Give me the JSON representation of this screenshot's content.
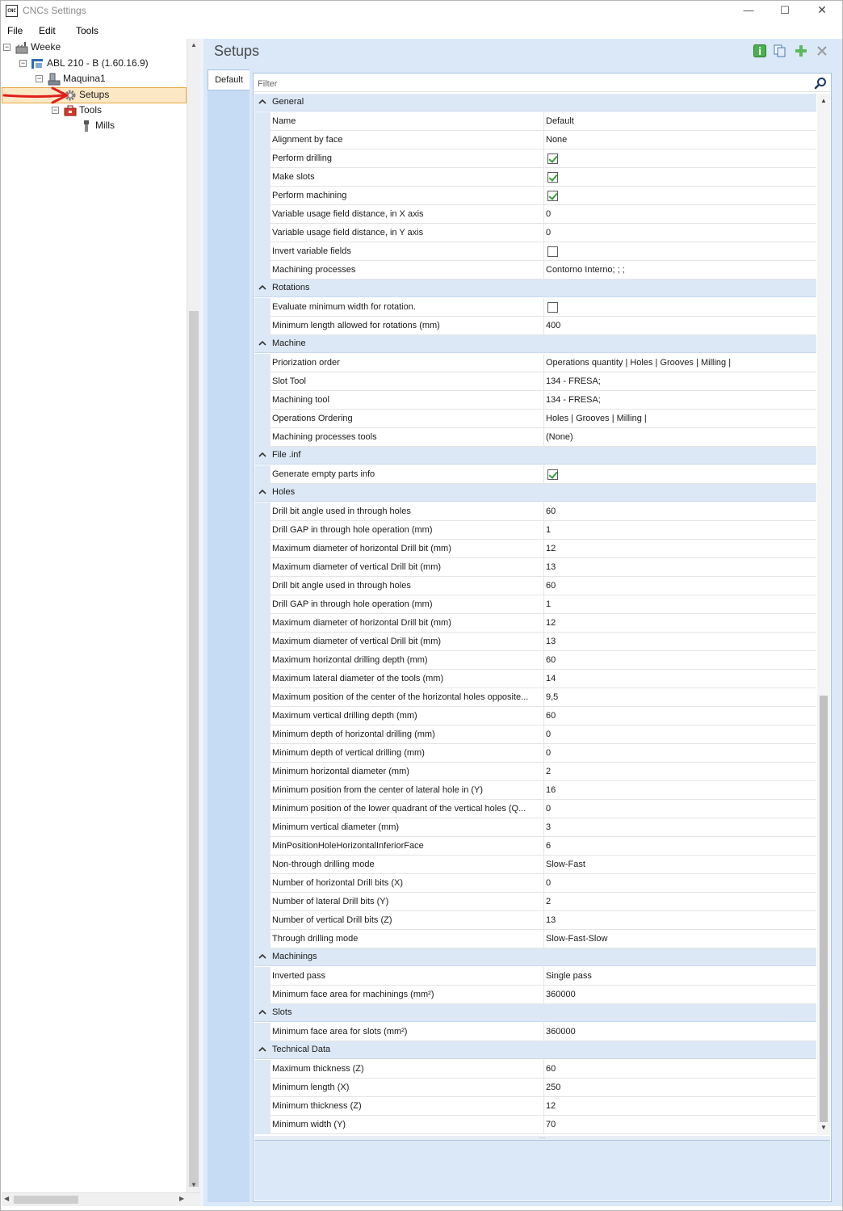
{
  "window": {
    "app_icon_text": "CNC",
    "title": "CNCs Settings",
    "minimize": "—",
    "maximize": "☐",
    "close": "✕"
  },
  "menu": [
    "File",
    "Edit",
    "Tools"
  ],
  "tree": {
    "root": "Weeke",
    "machine": "ABL 210 - B (1.60.16.9)",
    "maquina": "Maquina1",
    "setups": "Setups",
    "tools": "Tools",
    "mills": "Mills",
    "expander_open": "−"
  },
  "panel": {
    "title": "Setups",
    "tab_default": "Default",
    "filter_placeholder": "Filter",
    "grip": "....."
  },
  "colors": {
    "category_bg": "#dde8f6",
    "panel_bg": "#dae8f8",
    "selection_bg": "#fde8c6",
    "selection_border": "#e6a93e",
    "check_green": "#3a9c3a",
    "arrow_red": "#e0201c"
  },
  "grid": [
    {
      "type": "cat",
      "label": "General"
    },
    {
      "type": "prop",
      "name": "Name",
      "value": "Default"
    },
    {
      "type": "prop",
      "name": "Alignment by face",
      "value": "None"
    },
    {
      "type": "prop",
      "name": "Perform drilling",
      "check": true
    },
    {
      "type": "prop",
      "name": "Make slots",
      "check": true
    },
    {
      "type": "prop",
      "name": "Perform machining",
      "check": true
    },
    {
      "type": "prop",
      "name": "Variable usage field distance, in X axis",
      "value": "0"
    },
    {
      "type": "prop",
      "name": "Variable usage field distance, in Y axis",
      "value": "0"
    },
    {
      "type": "prop",
      "name": "Invert variable fields",
      "check": false
    },
    {
      "type": "prop",
      "name": "Machining processes",
      "value": "Contorno Interno; ; ;"
    },
    {
      "type": "cat",
      "label": "Rotations"
    },
    {
      "type": "prop",
      "name": "Evaluate minimum width for rotation.",
      "check": false
    },
    {
      "type": "prop",
      "name": "Minimum length allowed for rotations (mm)",
      "value": "400"
    },
    {
      "type": "cat",
      "label": "Machine"
    },
    {
      "type": "prop",
      "name": "Priorization order",
      "value": "Operations quantity | Holes | Grooves | Milling |"
    },
    {
      "type": "prop",
      "name": "Slot Tool",
      "value": "134 - FRESA;"
    },
    {
      "type": "prop",
      "name": "Machining tool",
      "value": "134 - FRESA;"
    },
    {
      "type": "prop",
      "name": "Operations Ordering",
      "value": "Holes | Grooves | Milling |"
    },
    {
      "type": "prop",
      "name": "Machining processes tools",
      "value": "(None)"
    },
    {
      "type": "cat",
      "label": "File .inf"
    },
    {
      "type": "prop",
      "name": "Generate empty parts info",
      "check": true
    },
    {
      "type": "cat",
      "label": "Holes"
    },
    {
      "type": "prop",
      "name": "Drill bit angle used in through holes",
      "value": "60"
    },
    {
      "type": "prop",
      "name": "Drill GAP in through hole operation (mm)",
      "value": "1"
    },
    {
      "type": "prop",
      "name": "Maximum diameter of horizontal Drill bit (mm)",
      "value": "12"
    },
    {
      "type": "prop",
      "name": "Maximum diameter of vertical Drill bit (mm)",
      "value": "13"
    },
    {
      "type": "prop",
      "name": "Drill bit angle used in through holes",
      "value": "60"
    },
    {
      "type": "prop",
      "name": "Drill GAP in through hole operation (mm)",
      "value": "1"
    },
    {
      "type": "prop",
      "name": "Maximum diameter of horizontal Drill bit (mm)",
      "value": "12"
    },
    {
      "type": "prop",
      "name": "Maximum diameter of vertical Drill bit (mm)",
      "value": "13"
    },
    {
      "type": "prop",
      "name": "Maximum horizontal drilling depth (mm)",
      "value": "60"
    },
    {
      "type": "prop",
      "name": "Maximum lateral diameter of the tools (mm)",
      "value": "14"
    },
    {
      "type": "prop",
      "name": "Maximum position of the center of the horizontal holes opposite...",
      "value": "9,5"
    },
    {
      "type": "prop",
      "name": "Maximum vertical drilling depth (mm)",
      "value": "60"
    },
    {
      "type": "prop",
      "name": "Minimum depth of horizontal drilling (mm)",
      "value": "0"
    },
    {
      "type": "prop",
      "name": "Minimum depth of vertical drilling (mm)",
      "value": "0"
    },
    {
      "type": "prop",
      "name": "Minimum horizontal diameter (mm)",
      "value": "2"
    },
    {
      "type": "prop",
      "name": "Minimum position from the center of lateral hole in (Y)",
      "value": "16"
    },
    {
      "type": "prop",
      "name": "Minimum position of the lower quadrant of the vertical holes (Q...",
      "value": "0"
    },
    {
      "type": "prop",
      "name": "Minimum vertical diameter (mm)",
      "value": "3"
    },
    {
      "type": "prop",
      "name": "MinPositionHoleHorizontalInferiorFace",
      "value": "6"
    },
    {
      "type": "prop",
      "name": "Non-through drilling mode",
      "value": "Slow-Fast"
    },
    {
      "type": "prop",
      "name": "Number of horizontal Drill bits (X)",
      "value": "0"
    },
    {
      "type": "prop",
      "name": "Number of lateral Drill bits (Y)",
      "value": "2"
    },
    {
      "type": "prop",
      "name": "Number of vertical Drill bits (Z)",
      "value": "13"
    },
    {
      "type": "prop",
      "name": "Through drilling mode",
      "value": "Slow-Fast-Slow"
    },
    {
      "type": "cat",
      "label": "Machinings"
    },
    {
      "type": "prop",
      "name": "Inverted pass",
      "value": "Single pass"
    },
    {
      "type": "prop",
      "name": "Minimum face area for machinings (mm²)",
      "value": "360000"
    },
    {
      "type": "cat",
      "label": "Slots"
    },
    {
      "type": "prop",
      "name": "Minimum face area for slots (mm²)",
      "value": "360000"
    },
    {
      "type": "cat",
      "label": "Technical Data"
    },
    {
      "type": "prop",
      "name": "Maximum thickness (Z)",
      "value": "60"
    },
    {
      "type": "prop",
      "name": "Minimum length (X)",
      "value": "250"
    },
    {
      "type": "prop",
      "name": "Minimum thickness (Z)",
      "value": "12"
    },
    {
      "type": "prop",
      "name": "Minimum width (Y)",
      "value": "70"
    }
  ]
}
